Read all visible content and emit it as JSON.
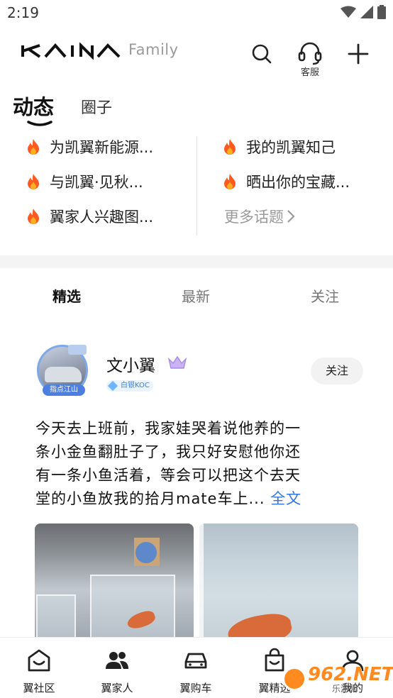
{
  "status_bar": {
    "time": "2:19"
  },
  "header": {
    "brand_suffix": "Family",
    "customer_service_label": "客服"
  },
  "top_tabs": [
    {
      "label": "动态",
      "active": true
    },
    {
      "label": "圈子",
      "active": false
    }
  ],
  "topics": {
    "left": [
      "为凯翼新能源...",
      "与凯翼·见秋...",
      "翼家人兴趣图..."
    ],
    "right": [
      "我的凯翼知己",
      "晒出你的宝藏..."
    ],
    "more_label": "更多话题"
  },
  "feed_tabs": [
    {
      "label": "精选",
      "active": true
    },
    {
      "label": "最新",
      "active": false
    },
    {
      "label": "关注",
      "active": false
    }
  ],
  "post": {
    "avatar_tag": "指点江山",
    "username": "文小翼",
    "badge": "白银KOC",
    "follow_label": "关注",
    "text_lines": [
      "今天去上班前，我家娃哭着说他养的一",
      "条小金鱼翻肚子了，我只好安慰他你还",
      "有一条小鱼活着，等会可以把这个去天",
      "堂的小鱼放我的拾月mate车上... "
    ],
    "fulltext_label": "全文"
  },
  "bottom_nav": [
    {
      "label": "翼社区",
      "icon": "community-icon"
    },
    {
      "label": "翼家人",
      "icon": "people-icon"
    },
    {
      "label": "翼购车",
      "icon": "car-icon"
    },
    {
      "label": "翼精选",
      "icon": "bag-icon"
    },
    {
      "label": "我的",
      "icon": "user-icon"
    }
  ],
  "watermark": {
    "text": "962.NET",
    "sub": "乐游网"
  },
  "colors": {
    "accent_blue": "#2f74e6",
    "fire_orange": "#ff5a1f",
    "muted_gray": "#9a9a9a"
  }
}
